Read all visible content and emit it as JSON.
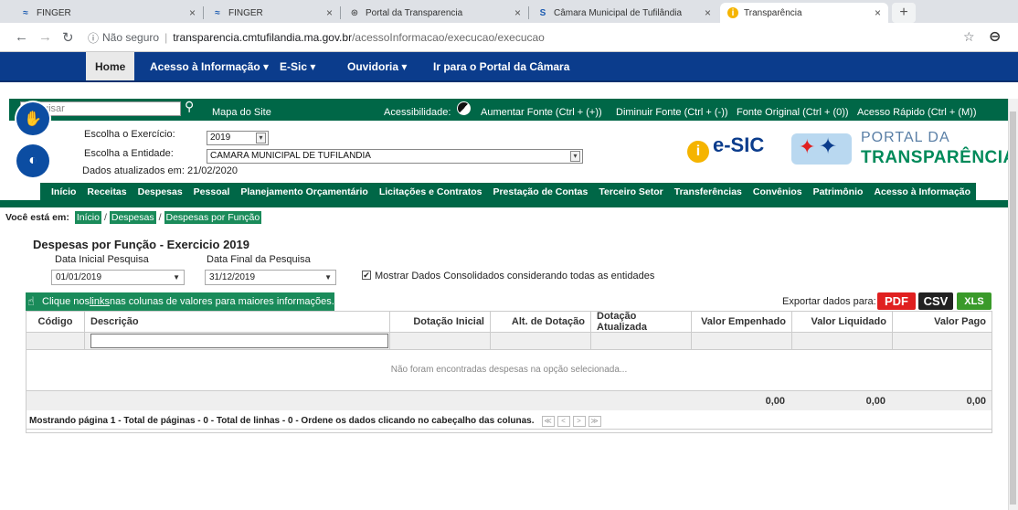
{
  "browser": {
    "tabs": [
      {
        "title": "FINGER",
        "active": false
      },
      {
        "title": "FINGER",
        "active": false
      },
      {
        "title": "Portal da Transparencia",
        "active": false
      },
      {
        "title": "Câmara Municipal de Tufilândia",
        "active": false
      },
      {
        "title": "Transparência",
        "active": true
      }
    ],
    "close_glyph": "×",
    "new_tab": "+",
    "not_secure": "Não seguro",
    "url_host": "transparencia.cmtufilandia.ma.gov.br",
    "url_path": "/acessoInformacao/execucao/execucao"
  },
  "topnav": {
    "items": [
      "Home",
      "Acesso à Informação ▾",
      "E-Sic ▾",
      "Ouvidoria ▾",
      "Ir para o Portal da Câmara"
    ]
  },
  "utility": {
    "search_placeholder": "uisar",
    "site_map": "Mapa do Site",
    "accessibility": "Acessibilidade:",
    "increase": "Aumentar Fonte (Ctrl + (+))",
    "decrease": "Diminuir Fonte (Ctrl + (-))",
    "original": "Fonte Original (Ctrl + (0))",
    "quick": "Acesso Rápido (Ctrl + (M))"
  },
  "filters": {
    "exercise_label": "Escolha o Exercício:",
    "exercise_value": "2019",
    "entity_label": "Escolha a Entidade:",
    "entity_value": "CAMARA MUNICIPAL DE TUFILANDIA",
    "updated": "Dados atualizados em: 21/02/2020"
  },
  "logos": {
    "esic": "e-SIC",
    "portal_line1": "PORTAL DA",
    "portal_line2": "TRANSPARÊNCIA"
  },
  "menu": {
    "items": [
      "Início",
      "Receitas",
      "Despesas",
      "Pessoal",
      "Planejamento Orçamentário",
      "Licitações e Contratos",
      "Prestação de Contas",
      "Terceiro Setor",
      "Transferências",
      "Convênios",
      "Patrimônio",
      "Acesso à Informação"
    ]
  },
  "breadcrumb": {
    "prefix": "Você está em:",
    "items": [
      "Início",
      "Despesas",
      "Despesas por Função"
    ],
    "sep": "/"
  },
  "report": {
    "title": "Despesas por Função - Exercicio 2019",
    "start_label": "Data Inicial Pesquisa",
    "end_label": "Data Final da Pesquisa",
    "start_value": "01/01/2019",
    "end_value": "31/12/2019",
    "consolidated_label": "Mostrar Dados Consolidados considerando todas as entidades",
    "info_pre": "Clique nos ",
    "info_link": "links",
    "info_post": " nas colunas de valores para maiores informações.",
    "export_label": "Exportar dados para:",
    "export_pdf": "PDF",
    "export_csv": "CSV",
    "export_xls": "XLS"
  },
  "table": {
    "columns": [
      "Código",
      "Descrição",
      "Dotação Inicial",
      "Alt. de Dotação",
      "Dotação Atualizada",
      "Valor Empenhado",
      "Valor Liquidado",
      "Valor Pago"
    ],
    "empty_message": "Não foram encontradas despesas na opção selecionada...",
    "totals": [
      "0,00",
      "0,00",
      "0,00"
    ],
    "pager_text": "Mostrando página 1 - Total de páginas - 0 - Total de linhas - 0 - Ordene os dados clicando no cabeçalho das colunas.",
    "pager_buttons": [
      "≪",
      "<",
      ">",
      "≫"
    ]
  },
  "colors": {
    "nav_blue": "#0b3c8c",
    "green": "#006747",
    "pdf": "#e02020",
    "csv": "#222222",
    "xls": "#3a9a2a"
  }
}
